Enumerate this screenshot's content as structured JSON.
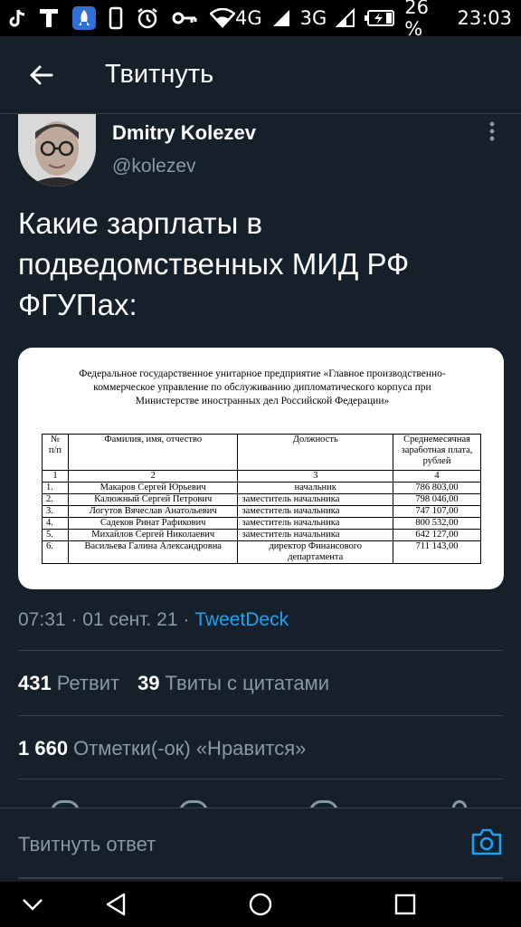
{
  "status_bar": {
    "icons": [
      "tiktok-icon",
      "t-app-icon",
      "rocket-app-icon",
      "phone-icon",
      "alarm-icon",
      "key-icon",
      "wifi-icon"
    ],
    "network1": "4G",
    "network2": "3G",
    "battery": "26 %",
    "time": "23:03"
  },
  "header": {
    "title": "Твитнуть"
  },
  "author": {
    "name": "Dmitry Kolezev",
    "handle": "@kolezev"
  },
  "tweet": {
    "text": "Какие зарплаты в подведомственных МИД РФ ФГУПах:"
  },
  "document": {
    "title": "Федеральное государственное унитарное предприятие «Главное производственно-коммерческое управление по обслуживанию дипломатического корпуса при Министерстве иностранных дел Российской Федерации»",
    "headers": [
      "№ п/п",
      "Фамилия, имя, отчество",
      "Должность",
      "Среднемесячная заработная плата, рублей"
    ],
    "index_row": [
      "1",
      "2",
      "3",
      "4"
    ],
    "rows": [
      [
        "1.",
        "Макаров Сергей Юрьевич",
        "начальник",
        "786 803,00"
      ],
      [
        "2.",
        "Калюжный Сергей Петрович",
        "заместитель начальника",
        "798 046,00"
      ],
      [
        "3.",
        "Логутов Вячеслав Анатольевич",
        "заместитель начальника",
        "747 107,00"
      ],
      [
        "4.",
        "Садеков Ринат Рафикович",
        "заместитель начальника",
        "800 532,00"
      ],
      [
        "5.",
        "Михайлов Сергей Николаевич",
        "заместитель начальника",
        "642 127,00"
      ],
      [
        "6.",
        "Васильева Галина Александровна",
        "директор Финансового департамента",
        "711 143,00"
      ]
    ]
  },
  "meta": {
    "time": "07:31",
    "date": "01 сент. 21",
    "sep": "·",
    "source": "TweetDeck"
  },
  "stats": {
    "retweets": "431",
    "retweets_label": "Ретвит",
    "quotes": "39",
    "quotes_label": "Твиты с цитатами",
    "likes": "1 660",
    "likes_label": "Отметки(-ок) «Нравится»"
  },
  "composer": {
    "placeholder": "Твитнуть ответ"
  },
  "colors": {
    "background": "#15202b",
    "accent": "#1da1f2",
    "muted": "#8899a6",
    "divider": "#38444d"
  }
}
